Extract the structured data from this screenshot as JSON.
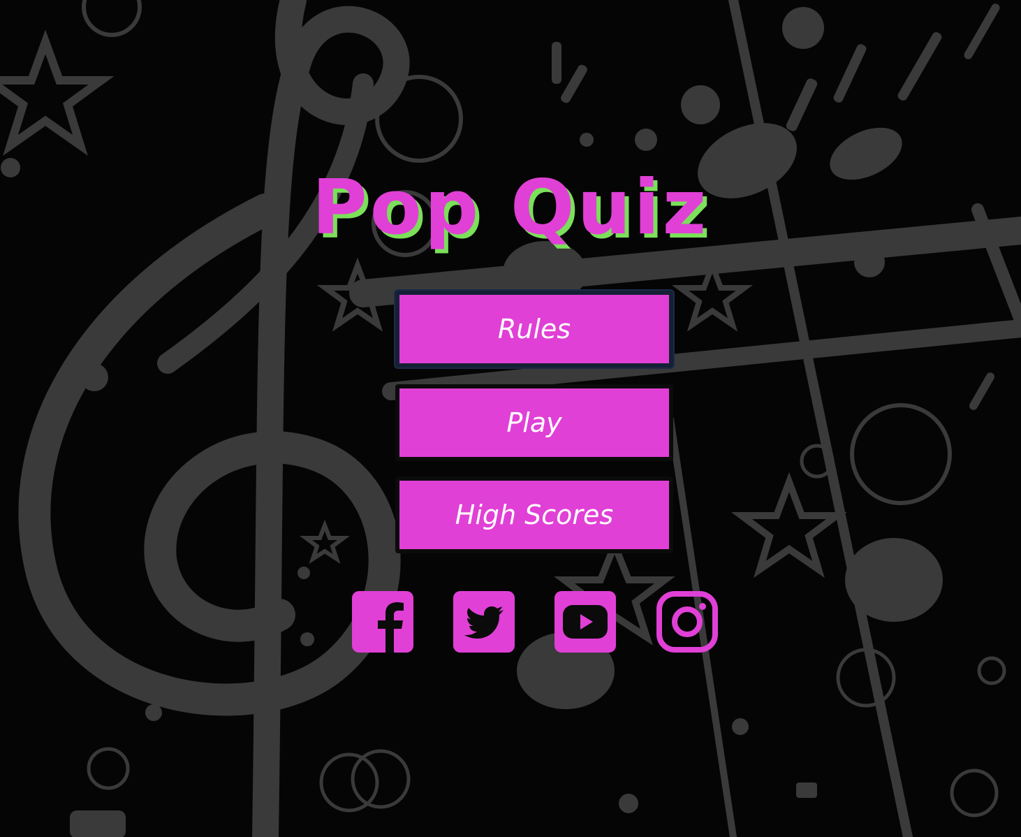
{
  "page": {
    "title": "Pop Quiz"
  },
  "menu": {
    "buttons": [
      {
        "label": "Rules",
        "focused": true
      },
      {
        "label": "Play",
        "focused": false
      },
      {
        "label": "High Scores",
        "focused": false
      }
    ]
  },
  "social": [
    {
      "name": "facebook",
      "icon": "facebook-icon"
    },
    {
      "name": "twitter",
      "icon": "twitter-icon"
    },
    {
      "name": "youtube",
      "icon": "youtube-icon"
    },
    {
      "name": "instagram",
      "icon": "instagram-icon"
    }
  ],
  "colors": {
    "accent": "#e040d6",
    "title_shadow": "#7be05a",
    "background": "#050505",
    "background_art": "#3a3a3a",
    "button_text": "#ffffff"
  }
}
